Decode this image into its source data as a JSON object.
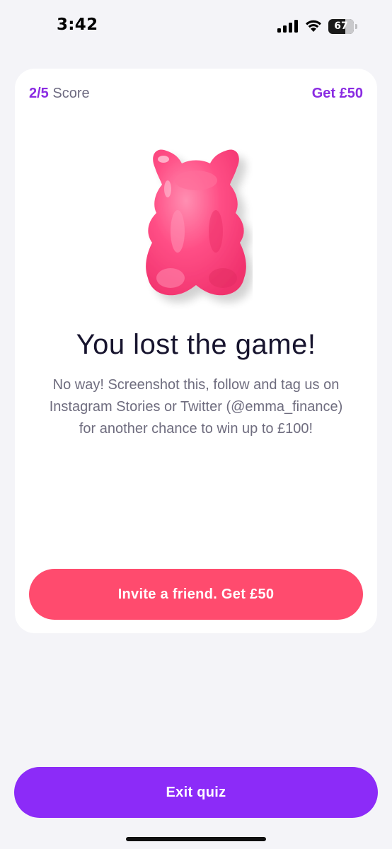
{
  "status_bar": {
    "time": "3:42",
    "battery_percent": "67",
    "battery_level": 0.67
  },
  "card": {
    "score_value": "2/5",
    "score_label": "Score",
    "header_reward": "Get £50",
    "image": "pink-gummy-bear",
    "title": "You lost the game!",
    "message": "No way! Screenshot this, follow and tag us on Instagram Stories or Twitter (@emma_finance) for another chance to win up to £100!",
    "invite_button_label": "Invite a friend. Get £50"
  },
  "exit_button_label": "Exit quiz",
  "colors": {
    "accent_purple": "#8c2bf8",
    "invite_pink": "#ff4b6e",
    "background": "#f4f4f8"
  }
}
